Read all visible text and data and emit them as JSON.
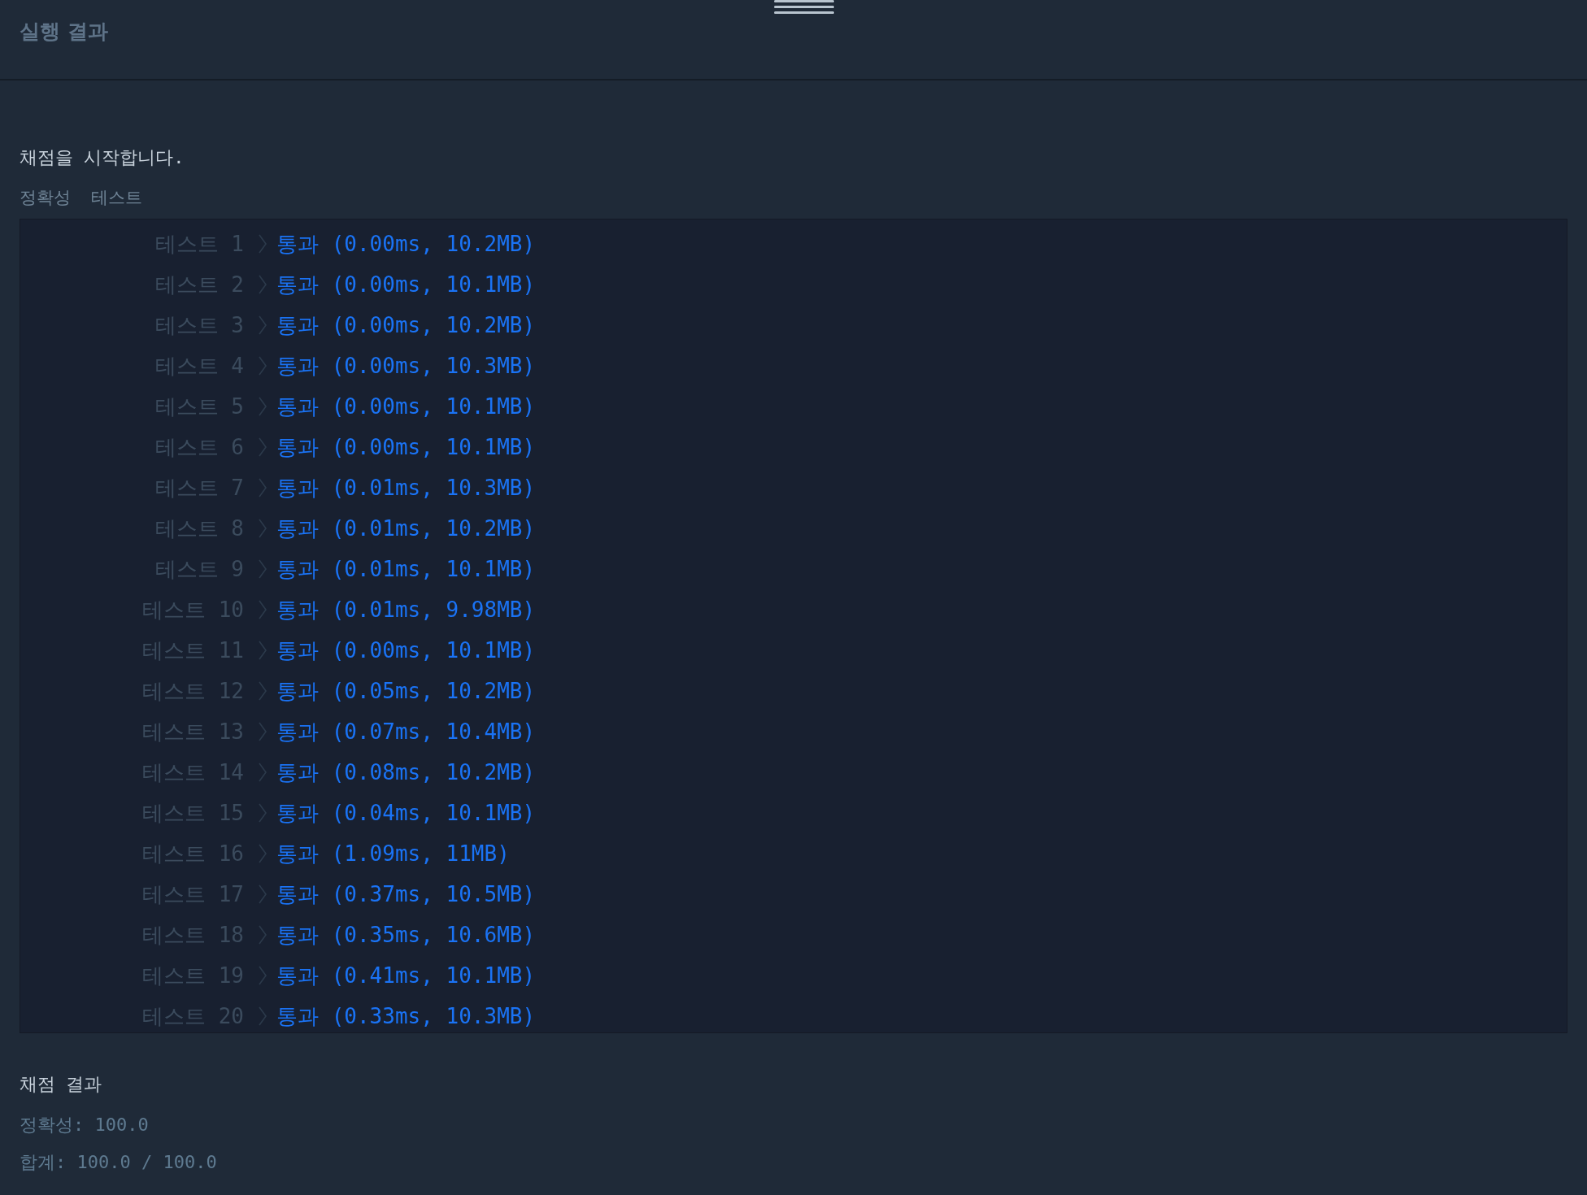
{
  "header": {
    "title": "실행 결과"
  },
  "intro": "채점을 시작합니다.",
  "section_label": "정확성  테스트",
  "tests": [
    {
      "label": "테스트 1",
      "result": "통과 (0.00ms, 10.2MB)"
    },
    {
      "label": "테스트 2",
      "result": "통과 (0.00ms, 10.1MB)"
    },
    {
      "label": "테스트 3",
      "result": "통과 (0.00ms, 10.2MB)"
    },
    {
      "label": "테스트 4",
      "result": "통과 (0.00ms, 10.3MB)"
    },
    {
      "label": "테스트 5",
      "result": "통과 (0.00ms, 10.1MB)"
    },
    {
      "label": "테스트 6",
      "result": "통과 (0.00ms, 10.1MB)"
    },
    {
      "label": "테스트 7",
      "result": "통과 (0.01ms, 10.3MB)"
    },
    {
      "label": "테스트 8",
      "result": "통과 (0.01ms, 10.2MB)"
    },
    {
      "label": "테스트 9",
      "result": "통과 (0.01ms, 10.1MB)"
    },
    {
      "label": "테스트 10",
      "result": "통과 (0.01ms, 9.98MB)"
    },
    {
      "label": "테스트 11",
      "result": "통과 (0.00ms, 10.1MB)"
    },
    {
      "label": "테스트 12",
      "result": "통과 (0.05ms, 10.2MB)"
    },
    {
      "label": "테스트 13",
      "result": "통과 (0.07ms, 10.4MB)"
    },
    {
      "label": "테스트 14",
      "result": "통과 (0.08ms, 10.2MB)"
    },
    {
      "label": "테스트 15",
      "result": "통과 (0.04ms, 10.1MB)"
    },
    {
      "label": "테스트 16",
      "result": "통과 (1.09ms, 11MB)"
    },
    {
      "label": "테스트 17",
      "result": "통과 (0.37ms, 10.5MB)"
    },
    {
      "label": "테스트 18",
      "result": "통과 (0.35ms, 10.6MB)"
    },
    {
      "label": "테스트 19",
      "result": "통과 (0.41ms, 10.1MB)"
    },
    {
      "label": "테스트 20",
      "result": "통과 (0.33ms, 10.3MB)"
    }
  ],
  "summary": {
    "title": "채점 결과",
    "lines": [
      "정확성: 100.0",
      "합계: 100.0 / 100.0"
    ]
  }
}
